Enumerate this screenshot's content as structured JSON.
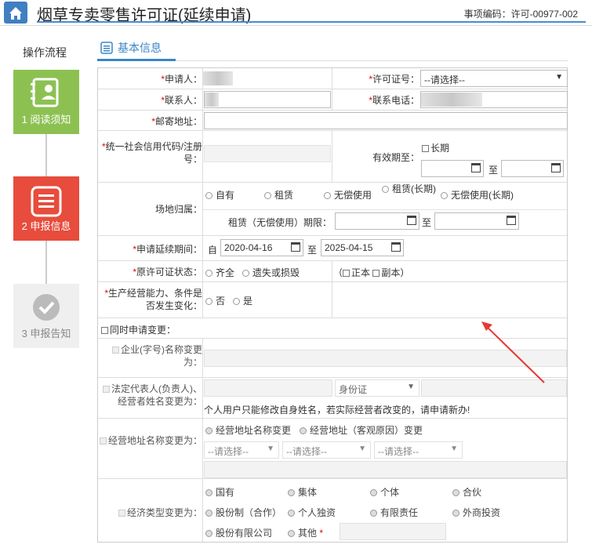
{
  "header": {
    "title": "烟草专卖零售许可证(延续申请)",
    "code": "事项编码：许可-00977-002"
  },
  "sidebar": {
    "title": "操作流程",
    "steps": [
      "1 阅读须知",
      "2 申报信息",
      "3 申报告知"
    ]
  },
  "tab": "基本信息",
  "f": {
    "applicant": "申请人：",
    "license_no": "许可证号：",
    "license_sel": "--请选择--",
    "contact": "联系人：",
    "phone": "联系电话：",
    "address": "邮寄地址：",
    "credit": "统一社会信用代码/注册号：",
    "valid": "有效期至：",
    "longterm": "长期",
    "to": "至",
    "site": "场地归属：",
    "site_opts": [
      "自有",
      "租赁",
      "无偿使用",
      "租赁(长期)",
      "无偿使用(长期)"
    ],
    "lease": "租赁（无偿使用）期限：",
    "ext": "申请延续期间：",
    "from": "自",
    "date1": "2020-04-16",
    "date2": "2025-04-15",
    "status": "原许可证状态：",
    "status_opts": [
      "齐全",
      "遗失或损毁"
    ],
    "lp": "（",
    "lz": "正本",
    "lf": "副本",
    "rp": "）",
    "prod": "生产经营能力、条件是否发生变化：",
    "no": "否",
    "yes": "是",
    "change": "同时申请变更：",
    "name_change": "企业(字号)名称变更为：",
    "rep_change": "法定代表人(负责人)、经营者姓名变更为：",
    "idcard": "身份证",
    "note": "个人用户只能修改自身姓名，若实际经营者改变的，请申请新办!",
    "addr_change": "经营地址名称变更为：",
    "addr_opts": [
      "经营地址名称变更",
      "经营地址（客观原因）变更"
    ],
    "sel_pl": "--请选择--",
    "econ_change": "经济类型变更为：",
    "econ_opts": [
      "国有",
      "集体",
      "个体",
      "合伙",
      "股份制（合作）",
      "个人独资",
      "有限责任",
      "外商投资",
      "股份有限公司",
      "其他"
    ]
  }
}
